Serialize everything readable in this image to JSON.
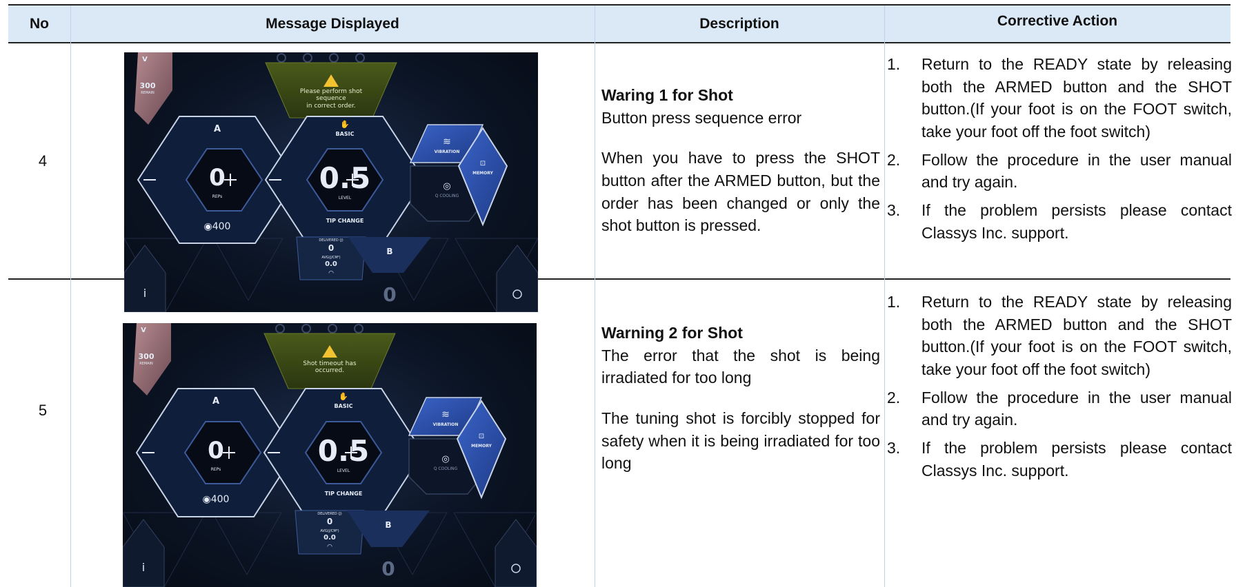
{
  "header": {
    "no": "No",
    "message": "Message Displayed",
    "description": "Description",
    "action": "Corrective Action"
  },
  "rows": [
    {
      "no": "4",
      "screen": {
        "remain_label_top": "V",
        "remain_value": "300",
        "remain_caption": "REMAIN",
        "warning_lines": [
          "Please perform shot",
          "sequence",
          "in correct order."
        ],
        "handpiece_a": "A",
        "reps_value": "0",
        "reps_caption": "REPs",
        "count_value": "400",
        "mode": "BASIC",
        "level_value": "0.5",
        "level_caption": "LEVEL",
        "tip_change": "TIP CHANGE",
        "vibration": "VIBRATION",
        "cooling": "Q COOLING",
        "memory": "MEMORY",
        "delivered_caption": "DELIVERED (J)",
        "delivered_value": "0",
        "avg_caption": "AVG(J/CM²)",
        "avg_value": "0.0",
        "handpiece_b": "B",
        "b_reps_value": "0",
        "info": "i"
      },
      "desc_title": "Waring 1 for Shot",
      "desc_sub": "Button press sequence error",
      "desc_body": "When you have to press the SHOT button after the ARMED button, but the order has been changed or only the shot button is pressed.",
      "actions": [
        {
          "num": "1.",
          "text": "Return to the READY state by releasing both the ARMED button and the SHOT button.(If your foot is on the FOOT switch, take your foot off the foot switch)"
        },
        {
          "num": "2.",
          "text": "Follow the procedure in the user manual and try again."
        },
        {
          "num": "3.",
          "text": "If the problem persists please contact Classys Inc. support."
        }
      ]
    },
    {
      "no": "5",
      "screen": {
        "remain_label_top": "V",
        "remain_value": "300",
        "remain_caption": "REMAIN",
        "warning_lines": [
          "Shot timeout has",
          "occurred."
        ],
        "handpiece_a": "A",
        "reps_value": "0",
        "reps_caption": "REPs",
        "count_value": "400",
        "mode": "BASIC",
        "level_value": "0.5",
        "level_caption": "LEVEL",
        "tip_change": "TIP CHANGE",
        "vibration": "VIBRATION",
        "cooling": "Q COOLING",
        "memory": "MEMORY",
        "delivered_caption": "DELIVERED (J)",
        "delivered_value": "0",
        "avg_caption": "AVG(J/CM²)",
        "avg_value": "0.0",
        "handpiece_b": "B",
        "b_reps_value": "0",
        "info": "i"
      },
      "desc_title": "Warning 2 for Shot",
      "desc_sub": "The error that the shot is being irradiated for too long",
      "desc_body": "The tuning shot is forcibly stopped for safety when it is being irradiated for too long",
      "actions": [
        {
          "num": "1.",
          "text": "Return to the READY state by releasing both the ARMED button and the SHOT button.(If your foot is on the FOOT switch, take your foot off the foot switch)"
        },
        {
          "num": "2.",
          "text": "Follow the procedure in the user manual and try again."
        },
        {
          "num": "3.",
          "text": "If the problem persists please contact Classys Inc. support."
        }
      ]
    }
  ]
}
